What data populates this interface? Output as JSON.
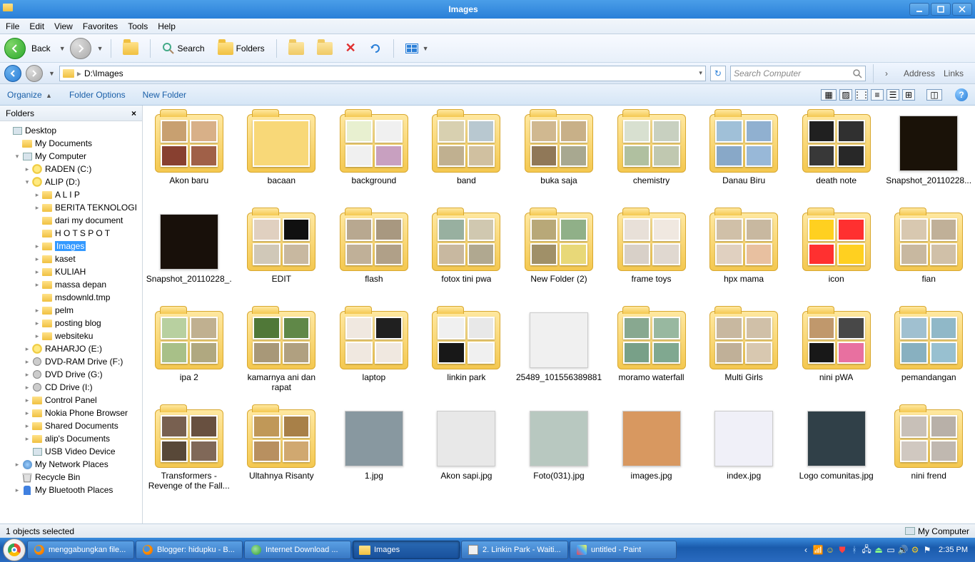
{
  "title": "Images",
  "menubar": [
    "File",
    "Edit",
    "View",
    "Favorites",
    "Tools",
    "Help"
  ],
  "toolbar": {
    "back": "Back",
    "search": "Search",
    "folders": "Folders"
  },
  "address": {
    "path": "D:\\Images",
    "search_placeholder": "Search Computer",
    "para_address": "Address",
    "para_links": "Links"
  },
  "orgbar": {
    "organize": "Organize",
    "folder_options": "Folder Options",
    "new_folder": "New Folder"
  },
  "sidebar": {
    "header": "Folders",
    "tree": [
      {
        "d": 0,
        "t": "",
        "i": "pci",
        "l": "Desktop"
      },
      {
        "d": 1,
        "t": "",
        "i": "fi",
        "l": "My Documents"
      },
      {
        "d": 1,
        "t": "▾",
        "i": "pci",
        "l": "My Computer"
      },
      {
        "d": 2,
        "t": "▸",
        "i": "di",
        "l": "RADEN (C:)"
      },
      {
        "d": 2,
        "t": "▾",
        "i": "di",
        "l": "ALIP (D:)"
      },
      {
        "d": 3,
        "t": "▸",
        "i": "fi",
        "l": "A   L   I   P"
      },
      {
        "d": 3,
        "t": "▸",
        "i": "fi",
        "l": "BERITA TEKNOLOGI"
      },
      {
        "d": 3,
        "t": "",
        "i": "fi",
        "l": "dari my document"
      },
      {
        "d": 3,
        "t": "",
        "i": "fi",
        "l": "H O T S P O T"
      },
      {
        "d": 3,
        "t": "▸",
        "i": "fi",
        "l": "Images",
        "sel": true
      },
      {
        "d": 3,
        "t": "▸",
        "i": "fi",
        "l": "kaset"
      },
      {
        "d": 3,
        "t": "▸",
        "i": "fi",
        "l": "KULIAH"
      },
      {
        "d": 3,
        "t": "▸",
        "i": "fi",
        "l": "massa depan"
      },
      {
        "d": 3,
        "t": "",
        "i": "fi",
        "l": "msdownld.tmp"
      },
      {
        "d": 3,
        "t": "▸",
        "i": "fi",
        "l": "pelm"
      },
      {
        "d": 3,
        "t": "▸",
        "i": "fi",
        "l": "posting blog"
      },
      {
        "d": 3,
        "t": "▸",
        "i": "fi",
        "l": "websiteku"
      },
      {
        "d": 2,
        "t": "▸",
        "i": "di",
        "l": "RAHARJO (E:)"
      },
      {
        "d": 2,
        "t": "▸",
        "i": "dvi",
        "l": "DVD-RAM Drive (F:)"
      },
      {
        "d": 2,
        "t": "▸",
        "i": "dvi",
        "l": "DVD Drive (G:)"
      },
      {
        "d": 2,
        "t": "▸",
        "i": "dvi",
        "l": "CD Drive (I:)"
      },
      {
        "d": 2,
        "t": "▸",
        "i": "fi",
        "l": "Control Panel"
      },
      {
        "d": 2,
        "t": "▸",
        "i": "fi",
        "l": "Nokia Phone Browser"
      },
      {
        "d": 2,
        "t": "▸",
        "i": "fi",
        "l": "Shared Documents"
      },
      {
        "d": 2,
        "t": "▸",
        "i": "fi",
        "l": "alip's Documents"
      },
      {
        "d": 2,
        "t": "",
        "i": "pci",
        "l": "USB Video Device"
      },
      {
        "d": 1,
        "t": "▸",
        "i": "neti",
        "l": "My Network Places"
      },
      {
        "d": 1,
        "t": "",
        "i": "bini",
        "l": "Recycle Bin"
      },
      {
        "d": 1,
        "t": "▸",
        "i": "bti",
        "l": "My Bluetooth Places"
      }
    ]
  },
  "items": [
    {
      "name": "Akon baru",
      "type": "folder",
      "pv": [
        "#c8a070",
        "#d8b088",
        "#884030",
        "#a06048"
      ]
    },
    {
      "name": "bacaan",
      "type": "folder",
      "pv": [
        "#f8d878"
      ]
    },
    {
      "name": "background",
      "type": "folder",
      "pv": [
        "#e8f0d0",
        "#f0f0f0",
        "#f0f0f0",
        "#c8a0c0"
      ]
    },
    {
      "name": "band",
      "type": "folder",
      "pv": [
        "#d8d0b0",
        "#b8c8d0",
        "#c0b090",
        "#d0c0a0"
      ]
    },
    {
      "name": "buka saja",
      "type": "folder",
      "pv": [
        "#d0b890",
        "#c8b088",
        "#907858",
        "#a8a890"
      ]
    },
    {
      "name": "chemistry",
      "type": "folder",
      "pv": [
        "#d8e0d0",
        "#c8d0c0",
        "#b0c0a0",
        "#c0c8b0"
      ]
    },
    {
      "name": "Danau Biru",
      "type": "folder",
      "pv": [
        "#a0c0d8",
        "#90b0d0",
        "#88a8c8",
        "#98b8d8"
      ]
    },
    {
      "name": "death note",
      "type": "folder",
      "pv": [
        "#202020",
        "#303030",
        "#383838",
        "#282828"
      ]
    },
    {
      "name": "Snapshot_20110228....",
      "type": "image",
      "bg": "#1a1208"
    },
    {
      "name": "Snapshot_20110228_...",
      "type": "image",
      "bg": "#18100a"
    },
    {
      "name": "EDIT",
      "type": "folder",
      "pv": [
        "#e0d0c0",
        "#101010",
        "#d0c8b8",
        "#c8b8a0"
      ]
    },
    {
      "name": "flash",
      "type": "folder",
      "pv": [
        "#b8a890",
        "#a89880",
        "#c0b098",
        "#b0a088"
      ]
    },
    {
      "name": "fotox tini pwa",
      "type": "folder",
      "pv": [
        "#98b0a0",
        "#d0c8b0",
        "#c8b8a0",
        "#b0a890"
      ]
    },
    {
      "name": "New Folder (2)",
      "type": "folder",
      "pv": [
        "#b8a878",
        "#90b088",
        "#a09068",
        "#e8d878"
      ]
    },
    {
      "name": "frame toys",
      "type": "folder",
      "pv": [
        "#e8e0d8",
        "#f0e8e0",
        "#d8d0c8",
        "#e0d8d0"
      ]
    },
    {
      "name": "hpx mama",
      "type": "folder",
      "pv": [
        "#d0c0a8",
        "#c8b8a0",
        "#e0d0c0",
        "#e8c0a0"
      ]
    },
    {
      "name": "icon",
      "type": "folder",
      "pv": [
        "#ffd020",
        "#ff3030",
        "#ff3030",
        "#ffd020"
      ]
    },
    {
      "name": "fian",
      "type": "folder",
      "pv": [
        "#d8c8b0",
        "#c0b098",
        "#c8b8a0",
        "#d0c0a8"
      ]
    },
    {
      "name": "ipa 2",
      "type": "folder",
      "pv": [
        "#b8d0a0",
        "#c0b090",
        "#a8c088",
        "#b0a880"
      ]
    },
    {
      "name": "kamarnya ani dan rapat",
      "type": "folder",
      "pv": [
        "#507838",
        "#608848",
        "#a89878",
        "#b0a080"
      ]
    },
    {
      "name": "laptop",
      "type": "folder",
      "pv": [
        "#f0e8e0",
        "#202020",
        "#f0e8e0",
        "#f0e8e0"
      ]
    },
    {
      "name": "linkin park",
      "type": "folder",
      "pv": [
        "#f0f0f0",
        "#e8e8e8",
        "#181818",
        "#f0f0f0"
      ]
    },
    {
      "name": "25489_101556389881...",
      "type": "image",
      "bg": "#f0f0f0"
    },
    {
      "name": "moramo waterfall",
      "type": "folder",
      "pv": [
        "#88a890",
        "#98b8a0",
        "#78a088",
        "#80a890"
      ]
    },
    {
      "name": "Multi Girls",
      "type": "folder",
      "pv": [
        "#c8b8a0",
        "#d0c0a8",
        "#c0b098",
        "#d8c8b0"
      ]
    },
    {
      "name": "nini pWA",
      "type": "folder",
      "pv": [
        "#c0986c",
        "#484848",
        "#181818",
        "#e870a0"
      ]
    },
    {
      "name": "pemandangan",
      "type": "folder",
      "pv": [
        "#a0c0d0",
        "#90b8c8",
        "#88b0c0",
        "#98c0d0"
      ]
    },
    {
      "name": "Transformers - Revenge of the Fall...",
      "type": "folder",
      "pv": [
        "#786050",
        "#685040",
        "#584838",
        "#806858"
      ]
    },
    {
      "name": "Ultahnya Risanty",
      "type": "folder",
      "pv": [
        "#c09858",
        "#a88048",
        "#b89060",
        "#d0a870"
      ]
    },
    {
      "name": "1.jpg",
      "type": "image",
      "bg": "#8898a0"
    },
    {
      "name": "Akon sapi.jpg",
      "type": "image",
      "bg": "#e8e8e8"
    },
    {
      "name": "Foto(031).jpg",
      "type": "image",
      "bg": "#b8c8c0"
    },
    {
      "name": "images.jpg",
      "type": "image",
      "bg": "#d89860"
    },
    {
      "name": "index.jpg",
      "type": "image",
      "bg": "#f0f0f8"
    },
    {
      "name": "Logo comunitas.jpg",
      "type": "image",
      "bg": "#304048"
    },
    {
      "name": "nini frend",
      "type": "folder",
      "pv": [
        "#c8c0b8",
        "#b8b0a8",
        "#d0c8c0",
        "#c0b8b0"
      ]
    }
  ],
  "status": {
    "left": "1 objects selected",
    "right": "My Computer"
  },
  "taskbar": {
    "buttons": [
      {
        "icon": "ff",
        "label": "menggabungkan file..."
      },
      {
        "icon": "ff",
        "label": "Blogger: hidupku - B..."
      },
      {
        "icon": "idm",
        "label": "Internet Download ..."
      },
      {
        "icon": "folder",
        "label": "Images",
        "active": true
      },
      {
        "icon": "note",
        "label": "2. Linkin Park - Waiti..."
      },
      {
        "icon": "paint",
        "label": "untitled - Paint"
      }
    ],
    "clock": "2:35 PM"
  }
}
